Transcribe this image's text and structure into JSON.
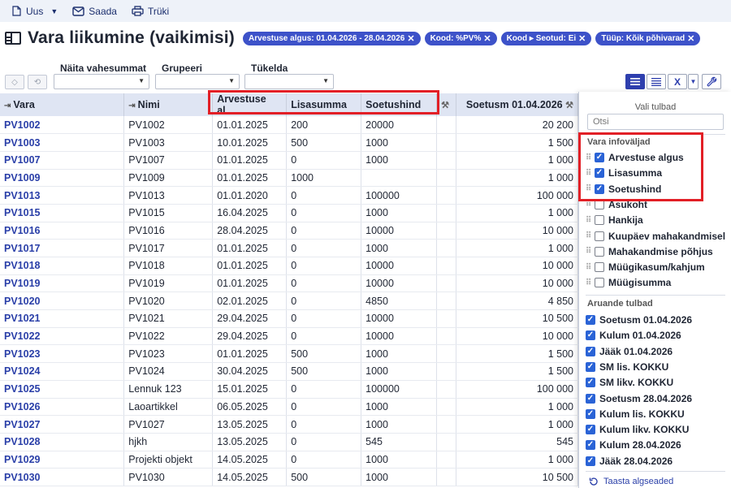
{
  "toolbar": {
    "new_label": "Uus",
    "send_label": "Saada",
    "print_label": "Trüki"
  },
  "header": {
    "title": "Vara liikumine (vaikimisi)",
    "chips": [
      "Arvestuse algus: 01.04.2026 - 28.04.2026",
      "Kood: %PV%",
      "Kood ▸ Seotud: Ei",
      "Tüüp: Kõik põhivarad"
    ]
  },
  "filters": {
    "subtotals_label": "Näita vahesummat",
    "group_label": "Grupeeri",
    "split_label": "Tükelda"
  },
  "table": {
    "headers": [
      "Vara",
      "Nimi",
      "Arvestuse al...",
      "Lisasumma",
      "Soetushind",
      "",
      "Soetusm 01.04.2026"
    ],
    "rows": [
      [
        "PV1002",
        "PV1002",
        "01.01.2025",
        "200",
        "20000",
        "20 200"
      ],
      [
        "PV1003",
        "PV1003",
        "10.01.2025",
        "500",
        "1000",
        "1 500"
      ],
      [
        "PV1007",
        "PV1007",
        "01.01.2025",
        "0",
        "1000",
        "1 000"
      ],
      [
        "PV1009",
        "PV1009",
        "01.01.2025",
        "1000",
        "",
        "1 000"
      ],
      [
        "PV1013",
        "PV1013",
        "01.01.2020",
        "0",
        "100000",
        "100 000"
      ],
      [
        "PV1015",
        "PV1015",
        "16.04.2025",
        "0",
        "1000",
        "1 000"
      ],
      [
        "PV1016",
        "PV1016",
        "28.04.2025",
        "0",
        "10000",
        "10 000"
      ],
      [
        "PV1017",
        "PV1017",
        "01.01.2025",
        "0",
        "1000",
        "1 000"
      ],
      [
        "PV1018",
        "PV1018",
        "01.01.2025",
        "0",
        "10000",
        "10 000"
      ],
      [
        "PV1019",
        "PV1019",
        "01.01.2025",
        "0",
        "10000",
        "10 000"
      ],
      [
        "PV1020",
        "PV1020",
        "02.01.2025",
        "0",
        "4850",
        "4 850"
      ],
      [
        "PV1021",
        "PV1021",
        "29.04.2025",
        "0",
        "10000",
        "10 500"
      ],
      [
        "PV1022",
        "PV1022",
        "29.04.2025",
        "0",
        "10000",
        "10 000"
      ],
      [
        "PV1023",
        "PV1023",
        "01.01.2025",
        "500",
        "1000",
        "1 500"
      ],
      [
        "PV1024",
        "PV1024",
        "30.04.2025",
        "500",
        "1000",
        "1 500"
      ],
      [
        "PV1025",
        "Lennuk 123",
        "15.01.2025",
        "0",
        "100000",
        "100 000"
      ],
      [
        "PV1026",
        "Laoartikkel",
        "06.05.2025",
        "0",
        "1000",
        "1 000"
      ],
      [
        "PV1027",
        "PV1027",
        "13.05.2025",
        "0",
        "1000",
        "1 000"
      ],
      [
        "PV1028",
        "hjkh",
        "13.05.2025",
        "0",
        "545",
        "545"
      ],
      [
        "PV1029",
        "Projekti objekt",
        "14.05.2025",
        "0",
        "1000",
        "1 000"
      ],
      [
        "PV1030",
        "PV1030",
        "14.05.2025",
        "500",
        "1000",
        "10 500"
      ]
    ]
  },
  "panel": {
    "title": "Vali tulbad",
    "search_placeholder": "Otsi",
    "info_section": "Vara infoväljad",
    "info_fields": [
      {
        "label": "Arvestuse algus",
        "checked": true
      },
      {
        "label": "Lisasumma",
        "checked": true
      },
      {
        "label": "Soetushind",
        "checked": true
      },
      {
        "label": "Asukoht",
        "checked": false
      },
      {
        "label": "Hankija",
        "checked": false
      },
      {
        "label": "Kuupäev mahakandmisel",
        "checked": false
      },
      {
        "label": "Mahakandmise põhjus",
        "checked": false
      },
      {
        "label": "Müügikasum/kahjum",
        "checked": false
      },
      {
        "label": "Müügisumma",
        "checked": false
      }
    ],
    "report_section": "Aruande tulbad",
    "report_fields": [
      {
        "label": "Soetusm 01.04.2026",
        "checked": true
      },
      {
        "label": "Kulum 01.04.2026",
        "checked": true
      },
      {
        "label": "Jääk 01.04.2026",
        "checked": true
      },
      {
        "label": "SM lis. KOKKU",
        "checked": true
      },
      {
        "label": "SM likv. KOKKU",
        "checked": true
      },
      {
        "label": "Soetusm 28.04.2026",
        "checked": true
      },
      {
        "label": "Kulum lis. KOKKU",
        "checked": true
      },
      {
        "label": "Kulum likv. KOKKU",
        "checked": true
      },
      {
        "label": "Kulum 28.04.2026",
        "checked": true
      },
      {
        "label": "Jääk 28.04.2026",
        "checked": true
      }
    ],
    "reset_label": "Taasta algseaded"
  },
  "colors": {
    "accent": "#3d52c9",
    "link": "#2a3fa8",
    "highlight_box": "#e21f26",
    "header_bg": "#dfe5f3"
  }
}
